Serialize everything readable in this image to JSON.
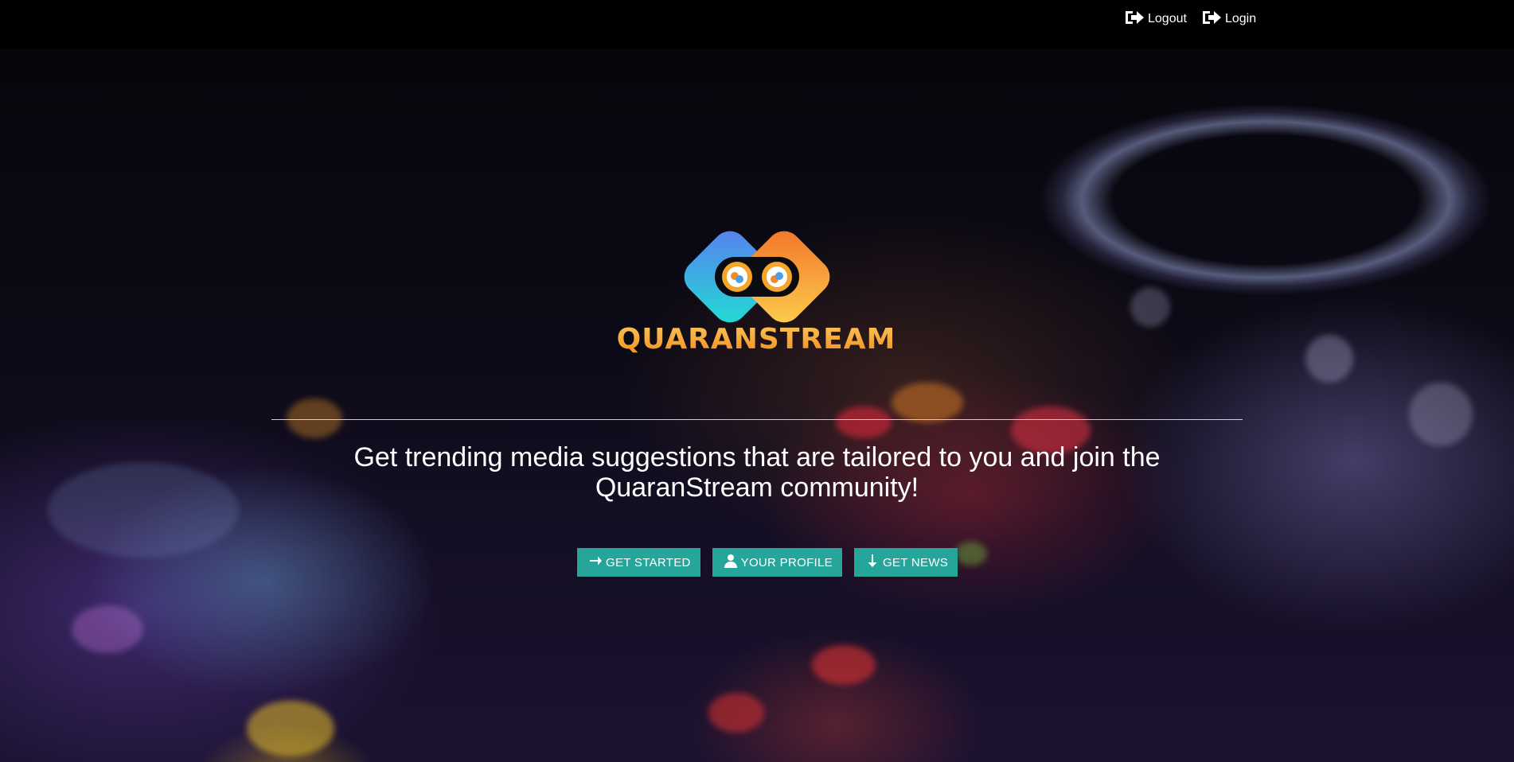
{
  "nav": {
    "links": [
      {
        "label": "Logout",
        "icon": "sign-out-icon"
      },
      {
        "label": "Login",
        "icon": "sign-in-icon"
      }
    ]
  },
  "hero": {
    "brand": "QUARANSTREAM",
    "tagline": "Get trending media suggestions that are tailored to you and join the QuaranStream community!",
    "buttons": [
      {
        "label": "GET STARTED",
        "icon": "arrow-right-icon"
      },
      {
        "label": "YOUR PROFILE",
        "icon": "user-icon"
      },
      {
        "label": "GET NEWS",
        "icon": "arrow-down-icon"
      }
    ]
  },
  "colors": {
    "button_bg": "#26a69a",
    "brand_text": "#f5a52a",
    "navbar_bg": "#000000"
  }
}
